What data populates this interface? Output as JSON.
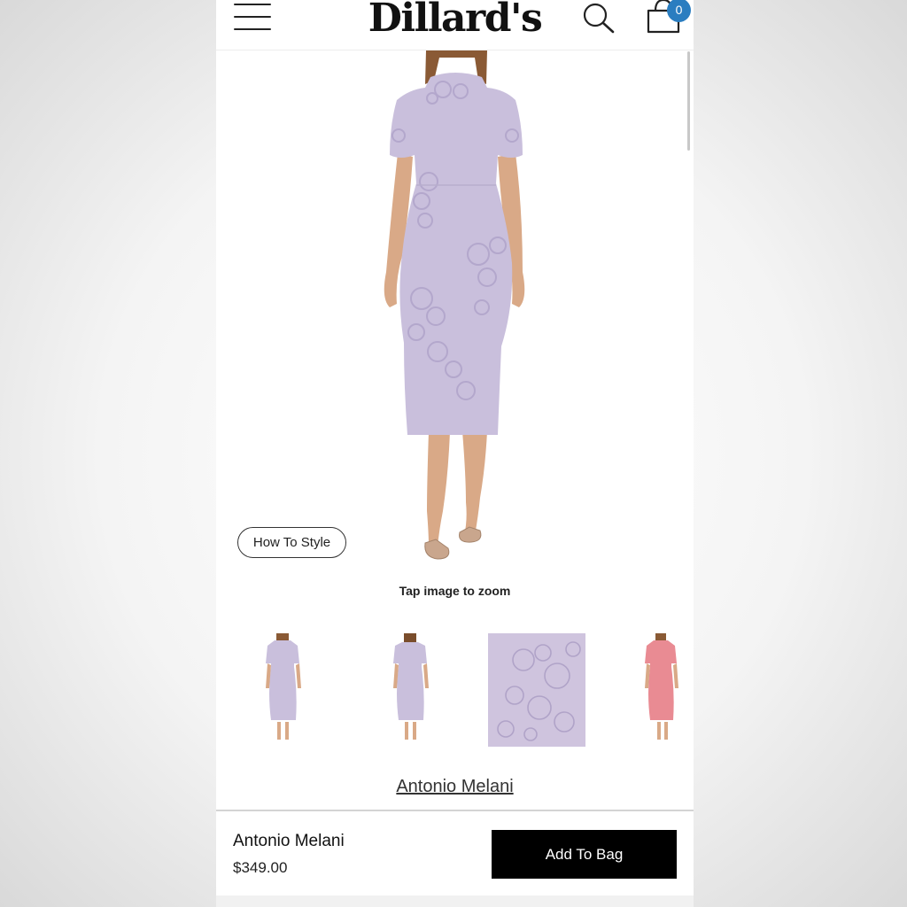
{
  "header": {
    "logo_text": "Dillard's",
    "menu_icon": "hamburger-menu-icon",
    "search_icon": "search-icon",
    "bag_icon": "shopping-bag-icon",
    "bag_count": "0",
    "badge_color": "#2a7dc0"
  },
  "product_image": {
    "dress_color": "#c9bfdc",
    "how_to_style_label": "How To Style",
    "zoom_hint": "Tap image to zoom"
  },
  "thumbnails": [
    {
      "kind": "front view",
      "color": "#c9bfdc"
    },
    {
      "kind": "back view",
      "color": "#c9bfdc"
    },
    {
      "kind": "fabric detail",
      "color": "#cfc4de"
    },
    {
      "kind": "alternate color",
      "color": "#e98b93"
    }
  ],
  "product": {
    "brand_link": "Antonio Melani",
    "brand": "Antonio Melani",
    "price": "$349.00",
    "add_to_bag_label": "Add To Bag"
  }
}
